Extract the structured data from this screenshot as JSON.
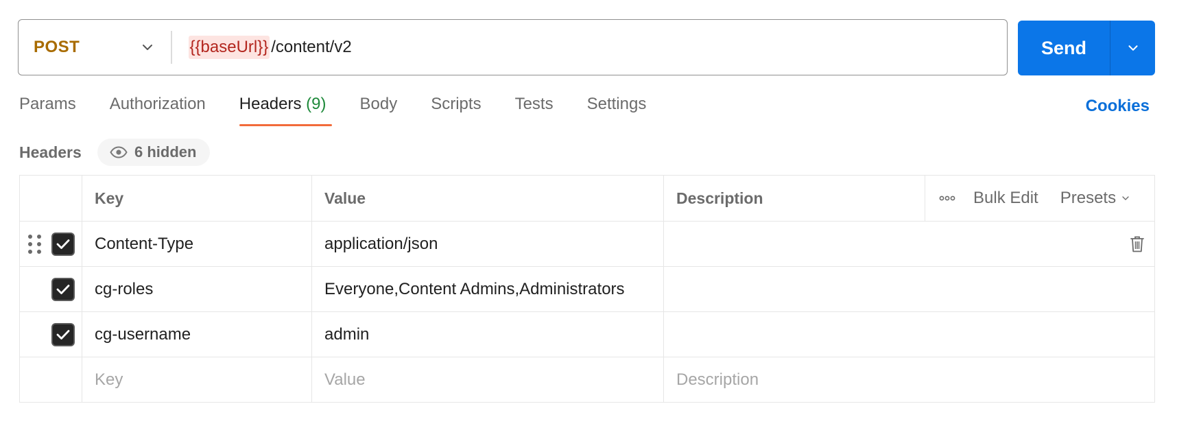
{
  "request": {
    "method": "POST",
    "url_variable": "{{baseUrl}}",
    "url_path": "/content/v2",
    "send_label": "Send"
  },
  "tabs": [
    {
      "label": "Params"
    },
    {
      "label": "Authorization"
    },
    {
      "label": "Headers",
      "count": "(9)",
      "active": true
    },
    {
      "label": "Body"
    },
    {
      "label": "Scripts"
    },
    {
      "label": "Tests"
    },
    {
      "label": "Settings"
    }
  ],
  "cookies_label": "Cookies",
  "headers_section": {
    "title": "Headers",
    "hidden_label": "6 hidden"
  },
  "table": {
    "columns": {
      "key": "Key",
      "value": "Value",
      "description": "Description"
    },
    "bulk_edit": "Bulk Edit",
    "presets": "Presets",
    "rows": [
      {
        "key": "Content-Type",
        "value": "application/json",
        "description": "",
        "checked": true
      },
      {
        "key": "cg-roles",
        "value": "Everyone,Content Admins,Administrators",
        "description": "",
        "checked": true
      },
      {
        "key": "cg-username",
        "value": "admin",
        "description": "",
        "checked": true
      }
    ],
    "placeholders": {
      "key": "Key",
      "value": "Value",
      "description": "Description"
    }
  },
  "colors": {
    "method": "#a86b00",
    "send": "#0b76e8",
    "active_tab_underline": "#f26b3a",
    "count": "#1f8a3b",
    "link": "#0a6fd9"
  },
  "icons": [
    "chevron-down-icon",
    "eye-icon",
    "more-horizontal-icon",
    "drag-handle-icon",
    "checkbox-checked-icon",
    "trash-icon"
  ]
}
